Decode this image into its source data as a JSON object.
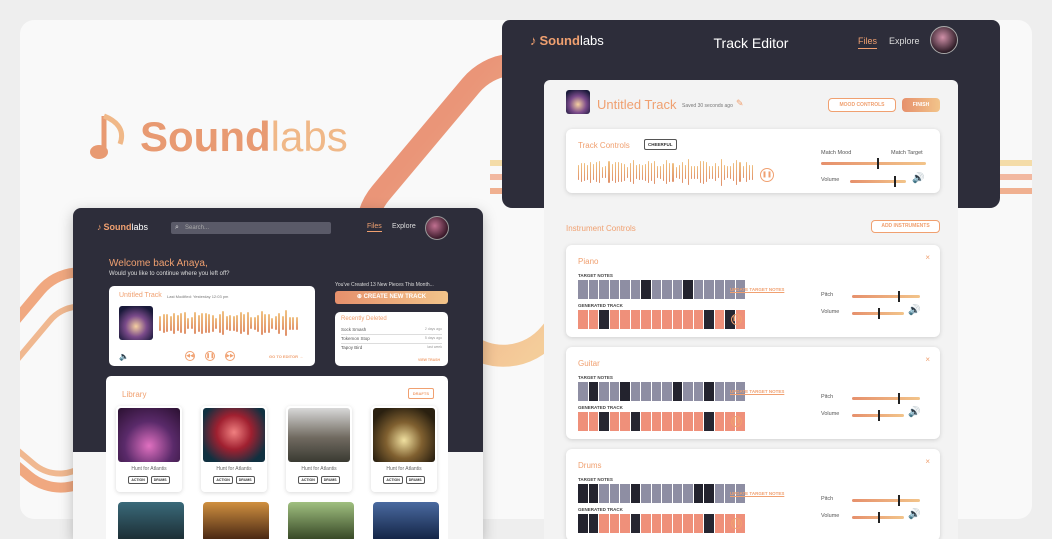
{
  "brand": {
    "bold": "Sound",
    "light": "labs"
  },
  "mini": {
    "logo_bold": "Sound",
    "logo_light": "labs",
    "search_placeholder": "Search...",
    "nav_files": "Files",
    "nav_explore": "Explore",
    "welcome": "Welcome back Anaya,",
    "welcome_sub": "Would you like to continue where you left off?",
    "track_title": "Untitled Track",
    "track_modified": "Last Modified: Yesterday 12:03 pm",
    "go_to_editor": "GO TO EDITOR →",
    "created_text": "You've Created 13 New  Pieces This Month...",
    "create_button": "CREATE NEW TRACK",
    "recent_title": "Recently Deleted",
    "recent": [
      {
        "name": "Sock Smash",
        "time": "2 days ago"
      },
      {
        "name": "Tokemon Stop",
        "time": "5 days ago"
      },
      {
        "name": "Tapoy Bird",
        "time": "last week"
      }
    ],
    "view_trash": "VIEW TRASH",
    "library_title": "Library",
    "drafts": "DRAFTS",
    "library_items": [
      {
        "name": "Hunt for Atlantis",
        "tags": [
          "ACTION",
          "DRUMS"
        ]
      },
      {
        "name": "Hunt for Atlantis",
        "tags": [
          "ACTION",
          "DRUMS"
        ]
      },
      {
        "name": "Hunt for Atlantis",
        "tags": [
          "ACTION",
          "DRUMS"
        ]
      },
      {
        "name": "Hunt for Atlantis",
        "tags": [
          "ACTION",
          "DRUMS"
        ]
      }
    ]
  },
  "editor": {
    "logo_bold": "Sound",
    "logo_light": "labs",
    "title": "Track Editor",
    "nav_files": "Files",
    "nav_explore": "Explore",
    "track_title": "Untitled Track",
    "saved": "Saved 30 seconds ago",
    "mood_controls": "MOOD CONTROLS",
    "finish": "FINISH",
    "track_controls": "Track Controls",
    "mood_badge": "CHEERFUL",
    "match_mood": "Match Mood",
    "match_target": "Match Target",
    "volume": "Volume",
    "mood_level": 0.53,
    "track_volume": 0.78,
    "instrument_controls": "Instrument Controls",
    "add_instruments": "ADD INSTRUMENTS",
    "instruments": [
      {
        "name": "Piano",
        "target_label": "TARGET NOTES",
        "update": "UPDATE TARGET NOTES",
        "generated_label": "GENERATED TRACK",
        "pitch_label": "Pitch",
        "volume_label": "Volume",
        "pitch": 0.68,
        "volume": 0.5
      },
      {
        "name": "Guitar",
        "target_label": "TARGET NOTES",
        "update": "UPDATE TARGET NOTES",
        "generated_label": "GENERATED TRACK",
        "pitch_label": "Pitch",
        "volume_label": "Volume",
        "pitch": 0.68,
        "volume": 0.5
      },
      {
        "name": "Drums",
        "target_label": "TARGET NOTES",
        "update": "UPDATE TARGET NOTES",
        "generated_label": "GENERATED TRACK",
        "pitch_label": "Pitch",
        "volume_label": "Volume",
        "pitch": 0.68,
        "volume": 0.5
      }
    ]
  },
  "colors": {
    "accent": "#f0a070",
    "accent_light": "#f2c48a",
    "dark": "#2d2d3a"
  }
}
